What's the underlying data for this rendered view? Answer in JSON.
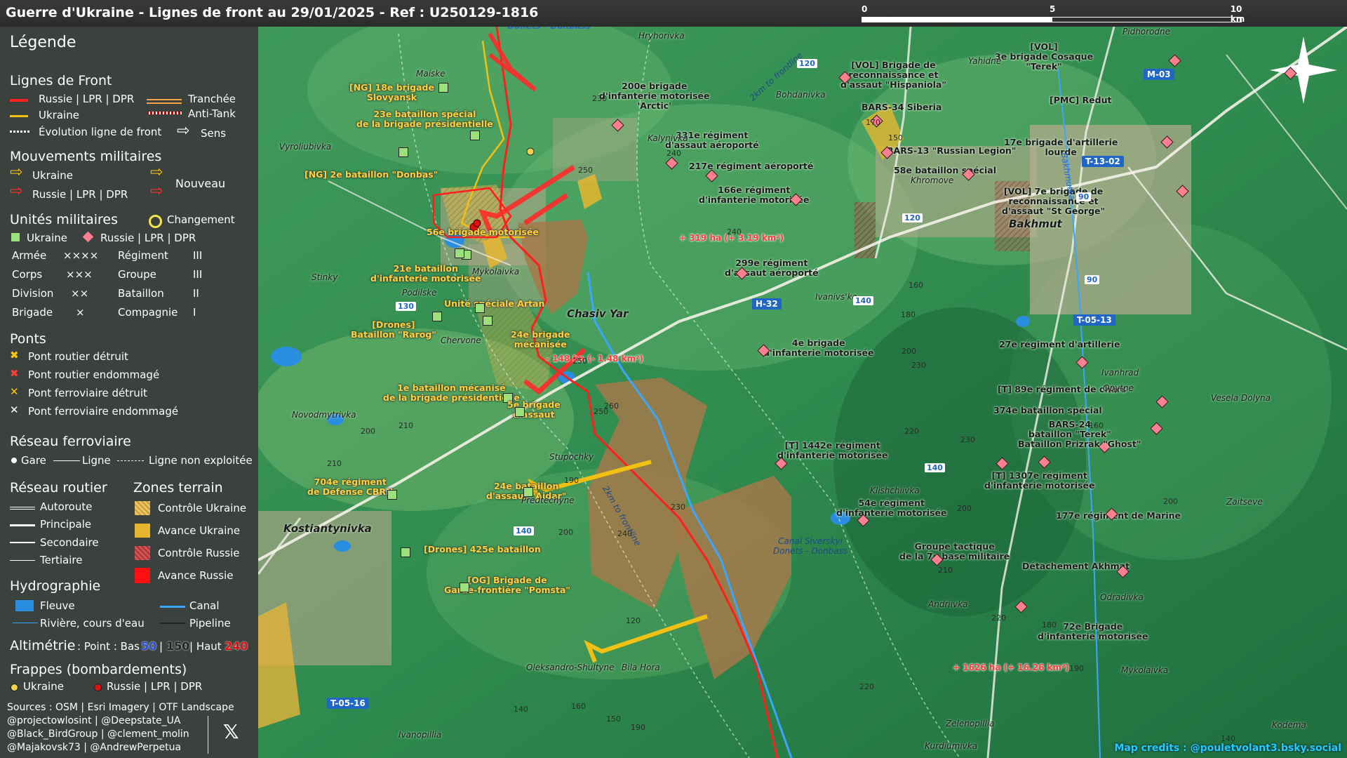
{
  "title": "Guerre d'Ukraine - Lignes de front au 29/01/2025 - Ref : U250129-1816",
  "scale": {
    "labels": [
      "0",
      "5",
      "10 km"
    ]
  },
  "compass": "N",
  "legend": {
    "title": "Légende",
    "front_lines": {
      "heading": "Lignes de Front",
      "russia": "Russie | LPR | DPR",
      "ukraine": "Ukraine",
      "trench": "Tranchée",
      "antitank": "Anti-Tank",
      "evolution": "Évolution ligne de front",
      "direction": "Sens"
    },
    "movements": {
      "heading": "Mouvements militaires",
      "ukraine": "Ukraine",
      "russia": "Russie | LPR | DPR",
      "new": "Nouveau"
    },
    "units": {
      "heading": "Unités militaires",
      "change": "Changement",
      "ukraine": "Ukraine",
      "russia": "Russie | LPR | DPR",
      "rows": [
        [
          "Armée",
          "××××",
          "Régiment",
          "III"
        ],
        [
          "Corps",
          "×××",
          "Groupe",
          "III"
        ],
        [
          "Division",
          "××",
          "Bataillon",
          "II"
        ],
        [
          "Brigade",
          "×",
          "Compagnie",
          "I"
        ]
      ]
    },
    "bridges": {
      "heading": "Ponts",
      "items": [
        "Pont routier détruit",
        "Pont routier endommagé",
        "Pont ferroviaire détruit",
        "Pont ferroviaire endommagé"
      ],
      "colors": [
        "#ffcc00",
        "#ff3b3b",
        "#ffcc00",
        "#ffffff"
      ]
    },
    "rail": {
      "heading": "Réseau ferroviaire",
      "station": "Gare",
      "line": "Ligne",
      "unused": "Ligne non exploitée"
    },
    "roads": {
      "heading": "Réseau routier",
      "items": [
        "Autoroute",
        "Principale",
        "Secondaire",
        "Tertiaire"
      ]
    },
    "zones": {
      "heading": "Zones terrain",
      "items": [
        "Contrôle Ukraine",
        "Avance Ukraine",
        "Contrôle Russie",
        "Avance Russie"
      ]
    },
    "hydro": {
      "heading": "Hydrographie",
      "river_big": "Fleuve",
      "canal": "Canal",
      "river": "Rivière, cours d'eau",
      "pipeline": "Pipeline"
    },
    "altimetry": {
      "label": "Altimétrie",
      "point": ": Point : Bas",
      "low": "50",
      "mid": "150",
      "high_label": "| Haut",
      "high": "240"
    },
    "strikes": {
      "heading": "Frappes (bombardements)",
      "ukraine": "Ukraine",
      "russia": "Russie | LPR | DPR"
    },
    "sources": [
      "Sources : OSM | Esri Imagery | OTF Landscape",
      "@projectowlosint | @Deepstate_UA",
      "@Black_BirdGroup | @clement_molin",
      "@Majakovsk73 | @AndrewPerpetua"
    ]
  },
  "map": {
    "ru_units": [
      {
        "t": "200e brigade\nd'infanterie motorisée\n'Arctic'"
      },
      {
        "t": "331e régiment\nd'assaut aéroporté"
      },
      {
        "t": "217e régiment aéroporté"
      },
      {
        "t": "166e régiment\nd'infanterie motorisée"
      },
      {
        "t": "[VOL] Brigade de\nreconnaissance et\nd'assaut \"Hispaniola\""
      },
      {
        "t": "BARS-34 Siberia"
      },
      {
        "t": "BARS-13 \"Russian Legion\""
      },
      {
        "t": "58e bataillon spécial"
      },
      {
        "t": "[VOL]\n3e brigade Cosaque\n\"Terek\""
      },
      {
        "t": "[PMC] Redut"
      },
      {
        "t": "17e brigade d'artillerie\nlourde"
      },
      {
        "t": "[VOL] 7e brigade de\nreconnaissance et\nd'assaut \"St George\""
      },
      {
        "t": "299e régiment\nd'assaut aéroporté"
      },
      {
        "t": "4e brigade\nd'infanterie motorisée"
      },
      {
        "t": "27e régiment d'artillerie"
      },
      {
        "t": "[T] 89e régiment de chars"
      },
      {
        "t": "374e bataillon spécial"
      },
      {
        "t": "BARS-24\nbataillon \"Terek\""
      },
      {
        "t": "Bataillon Prizrak \"Ghost\""
      },
      {
        "t": "[T] 1442e régiment\nd'infanterie motorisée"
      },
      {
        "t": "[T] 1307e régiment\nd'infanterie motorisée"
      },
      {
        "t": "54e régiment\nd'infanterie motorisée"
      },
      {
        "t": "177e régiment de Marine"
      },
      {
        "t": "Groupe tactique\nde la 7e base militaire"
      },
      {
        "t": "Détachement Akhmat"
      },
      {
        "t": "72e Brigade\nd'infanterie motorisée"
      }
    ],
    "ua_units": [
      {
        "t": "[NG] 18e brigade\nSlovyansk"
      },
      {
        "t": "23e bataillon spécial\nde la brigade présidentielle"
      },
      {
        "t": "[NG] 2e bataillon \"Donbas\""
      },
      {
        "t": "56e brigade motorisée"
      },
      {
        "t": "21e bataillon\nd'infanterie motorisée"
      },
      {
        "t": "Unité spéciale Artan"
      },
      {
        "t": "[Drones]\nBataillon \"Rarog\""
      },
      {
        "t": "24e brigade\nmécanisée"
      },
      {
        "t": "1e bataillon mécanisé\nde la brigade présidentielle"
      },
      {
        "t": "5e brigade\nd'assaut"
      },
      {
        "t": "704e régiment\nde Défense CBRN"
      },
      {
        "t": "24e bataillon\nd'assaut \"Aidar\""
      },
      {
        "t": "[Drones] 425e bataillon"
      },
      {
        "t": "[OG] Brigade de\nGarde-frontière \"Pomsta\""
      }
    ],
    "changes": [
      "+ 319 ha (+ 3.19 km²)",
      "- 148 ha (- 1.48 km²)",
      "+ 1626 ha (+ 16.26 km²)"
    ],
    "towns": [
      "Hryhorivka",
      "Maiske",
      "Kalynivka",
      "Bohdanivka",
      "Yahidne",
      "Pidhorodne",
      "Khromove",
      "Bakhmut",
      "Vyroliubivka",
      "Stinky",
      "Mykolaivka",
      "Podilske",
      "Chasiv Yar",
      "Ivanivs'ke",
      "Chervone",
      "Novodmytrivka",
      "Stupochky",
      "Predtechyne",
      "Kostiantynivka",
      "Klishchiivka",
      "Ivanhrad",
      "Opytne",
      "Vesela Dolyna",
      "Zaitseve",
      "Odradivka",
      "Andriivka",
      "Oleksandro-Shultyne",
      "Bila Hora",
      "Ivanopillia",
      "Zelenopillia",
      "Kurdiumivka",
      "Mykolaivka",
      "Kodema"
    ],
    "roads": [
      "M-03",
      "T-13-02",
      "H-32",
      "T-05-13",
      "T-05-16"
    ],
    "road_numbers": [
      "120",
      "90",
      "90",
      "140",
      "130",
      "140",
      "140",
      "120"
    ],
    "elevations": [
      "230",
      "240",
      "170",
      "150",
      "250",
      "240",
      "160",
      "180",
      "200",
      "230",
      "250",
      "260",
      "250",
      "210",
      "200",
      "210",
      "190",
      "230",
      "240",
      "200",
      "220",
      "230",
      "200",
      "210",
      "220",
      "220",
      "190",
      "180",
      "120",
      "140",
      "160",
      "150",
      "190",
      "160",
      "200",
      "140"
    ],
    "frontline_notes": [
      "2km to frontline",
      "2km to frontline"
    ],
    "canal": "Canal Siverskyi\nDonets - Donbass",
    "canal_top": "Donets - Donbass",
    "river": "Bakhmutka",
    "credit": "Map credits : @pouletvolant3.bsky.social"
  }
}
